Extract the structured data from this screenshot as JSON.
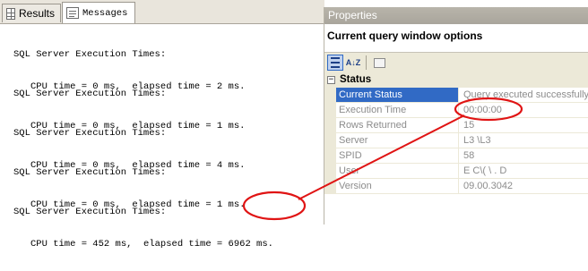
{
  "tabs": [
    {
      "label": "Results",
      "icon": "grid-icon"
    },
    {
      "label": "Messages",
      "icon": "message-icon"
    }
  ],
  "messages": [
    {
      "line1": "SQL Server Execution Times:",
      "line2": "CPU time = 0 ms,  elapsed time = 2 ms."
    },
    {
      "line1": "SQL Server Execution Times:",
      "line2": "CPU time = 0 ms,  elapsed time = 1 ms."
    },
    {
      "line1": "SQL Server Execution Times:",
      "line2": "CPU time = 0 ms,  elapsed time = 4 ms."
    },
    {
      "line1": "SQL Server Execution Times:",
      "line2": "CPU time = 0 ms,  elapsed time = 1 ms."
    },
    {
      "line1": "SQL Server Execution Times:",
      "line2": "CPU time = 452 ms,  elapsed time = 6962 ms."
    }
  ],
  "properties": {
    "title": "Properties",
    "header": "Current query window options",
    "category": "Status",
    "category_toggle": "−",
    "toolbar": {
      "categorized_icon": "categorized-icon",
      "sort_label": "A↓Z",
      "pages_icon": "property-pages-icon"
    },
    "rows": [
      {
        "name": "Current Status",
        "value": "Query executed successfully"
      },
      {
        "name": "Execution Time",
        "value": "00:00:00"
      },
      {
        "name": "Rows Returned",
        "value": "15"
      },
      {
        "name": "Server",
        "value": "L3  \\L3"
      },
      {
        "name": "SPID",
        "value": "58"
      },
      {
        "name": "User",
        "value": "E  C\\(   \\ . D"
      },
      {
        "name": "Version",
        "value": "09.00.3042"
      }
    ]
  },
  "colors": {
    "annotation": "#e01414",
    "selection": "#316ac5",
    "panel": "#ece9d8"
  }
}
